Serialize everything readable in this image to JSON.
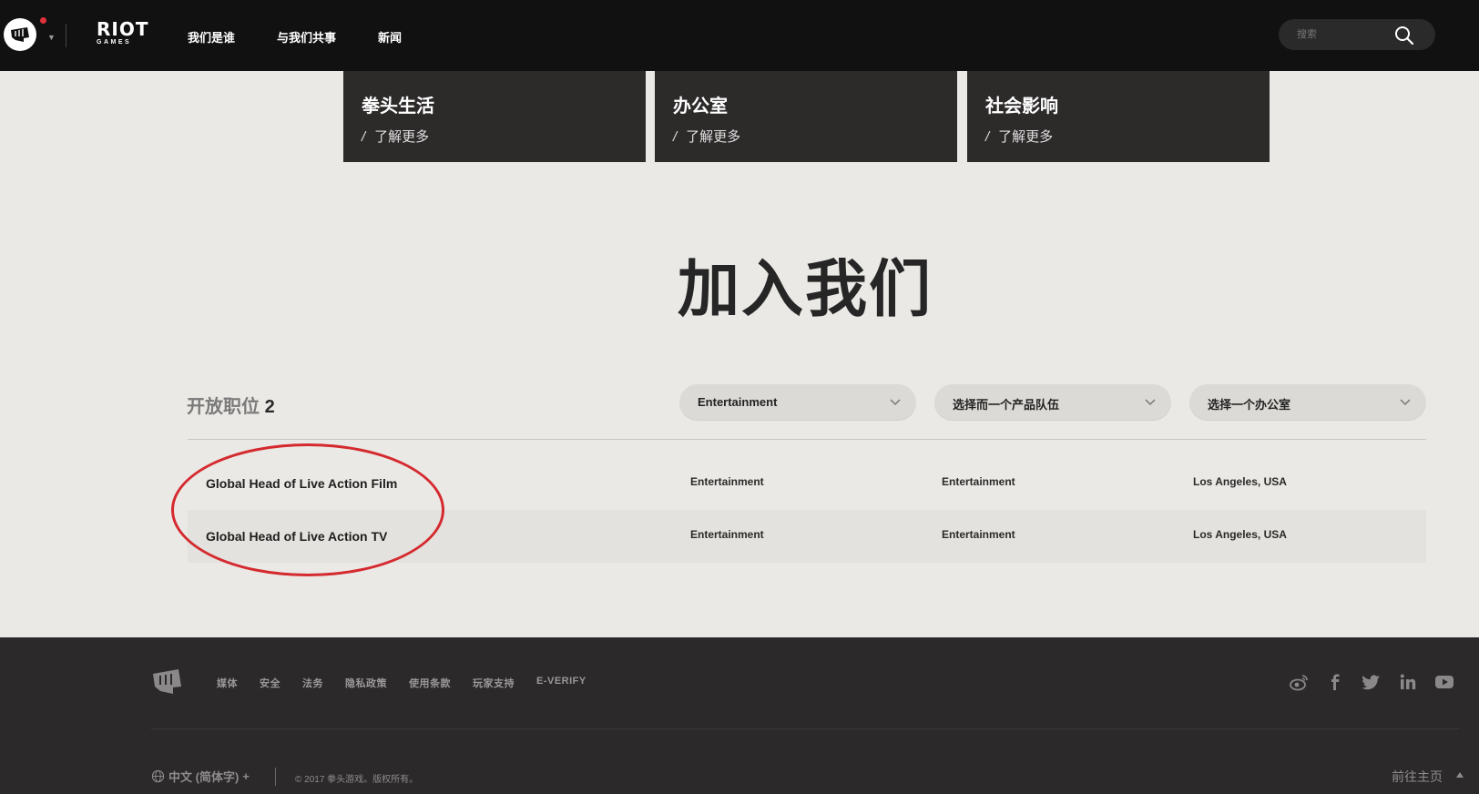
{
  "header": {
    "nav": [
      "我们是谁",
      "与我们共事",
      "新闻"
    ],
    "logo_word": "RIOT",
    "logo_sub": "GAMES",
    "search_placeholder": "搜索"
  },
  "cards": [
    {
      "title": "拳头生活",
      "link": "了解更多"
    },
    {
      "title": "办公室",
      "link": "了解更多"
    },
    {
      "title": "社会影响",
      "link": "了解更多"
    }
  ],
  "join_title": "加入我们",
  "open_positions": {
    "label": "开放职位",
    "count": "2"
  },
  "filters": [
    "Entertainment",
    "选择而一个产品队伍",
    "选择一个办公室"
  ],
  "jobs": [
    {
      "title": "Global Head of Live Action Film",
      "craft": "Entertainment",
      "team": "Entertainment",
      "office": "Los Angeles, USA"
    },
    {
      "title": "Global Head of Live Action TV",
      "craft": "Entertainment",
      "team": "Entertainment",
      "office": "Los Angeles, USA"
    }
  ],
  "footer": {
    "links": [
      "媒体",
      "安全",
      "法务",
      "隐私政策",
      "使用条款",
      "玩家支持",
      "E-VERIFY"
    ],
    "social_icons": [
      "weibo-icon",
      "facebook-icon",
      "twitter-icon",
      "linkedin-icon",
      "youtube-icon"
    ],
    "language": "中文 (简体字)",
    "language_plus": "+",
    "copyright": "© 2017 拳头游戏。版权所有。",
    "back_home": "前往主页"
  },
  "colors": {
    "header_bg": "#111111",
    "page_bg": "#ebe9e5",
    "card_bg": "#2d2a2a",
    "footer_bg": "#2b2929",
    "annotation_red": "#d42a2f",
    "notification_dot": "#e0313a"
  }
}
